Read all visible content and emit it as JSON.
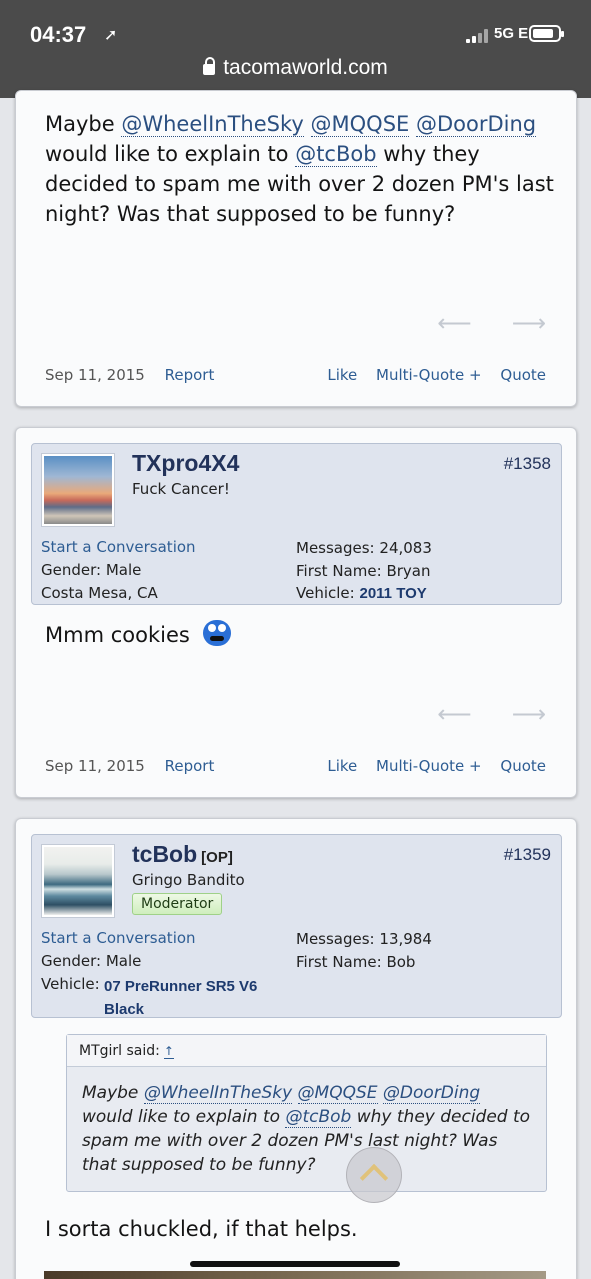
{
  "status_bar": {
    "time": "04:37",
    "network": "5G E"
  },
  "browser": {
    "url": "tacomaworld.com"
  },
  "post1": {
    "message_parts": [
      {
        "text": "Maybe "
      },
      {
        "text": "@WheelInTheSky",
        "mention": true
      },
      {
        "text": " "
      },
      {
        "text": "@MQQSE",
        "mention": true
      },
      {
        "text": " "
      },
      {
        "text": "@DoorDing",
        "mention": true
      },
      {
        "text": " would like to explain to "
      },
      {
        "text": "@tcBob",
        "mention": true
      },
      {
        "text": " why they decided to spam me with over 2 dozen PM's last night? Was that supposed to be funny?"
      }
    ],
    "date": "Sep 11, 2015",
    "report": "Report",
    "like": "Like",
    "multiquote": "Multi-Quote +",
    "quote": "Quote"
  },
  "post2": {
    "username": "TXpro4X4",
    "user_title": "Fuck Cancer!",
    "post_number": "#1358",
    "start_conversation": "Start a Conversation",
    "gender": "Gender: Male",
    "location": "Costa Mesa, CA",
    "messages_label": "Messages:",
    "messages_value": "24,083",
    "first_name_label": "First Name:",
    "first_name_value": "Bryan",
    "vehicle_label": "Vehicle:",
    "vehicle_value": "2011 TOY",
    "message": "Mmm cookies",
    "date": "Sep 11, 2015",
    "report": "Report",
    "like": "Like",
    "multiquote": "Multi-Quote +",
    "quote": "Quote"
  },
  "post3": {
    "username": "tcBob",
    "op_badge": "[OP]",
    "user_title": "Gringo Bandito",
    "role_badge": "Moderator",
    "post_number": "#1359",
    "start_conversation": "Start a Conversation",
    "gender": "Gender: Male",
    "vehicle_label": "Vehicle:",
    "vehicle_line1": "07 PreRunner SR5 V6",
    "vehicle_line2": "Black",
    "messages_label": "Messages:",
    "messages_value": "13,984",
    "first_name_label": "First Name:",
    "first_name_value": "Bob",
    "quote_author": "MTgirl said:",
    "quote_up": "↑",
    "quote_parts": [
      {
        "text": "Maybe "
      },
      {
        "text": "@WheelInTheSky",
        "mention": true
      },
      {
        "text": " "
      },
      {
        "text": "@MQQSE",
        "mention": true
      },
      {
        "text": " "
      },
      {
        "text": "@DoorDing",
        "mention": true
      },
      {
        "text": " would like to explain to "
      },
      {
        "text": "@tcBob",
        "mention": true
      },
      {
        "text": " why they decided to spam me with over 2 dozen PM's last night? Was that supposed to be funny?"
      }
    ],
    "message": "I sorta chuckled, if that helps."
  },
  "colors": {
    "accent": "#2e5d93",
    "username": "#22325a",
    "userbox_bg": "#dfe4ee"
  }
}
